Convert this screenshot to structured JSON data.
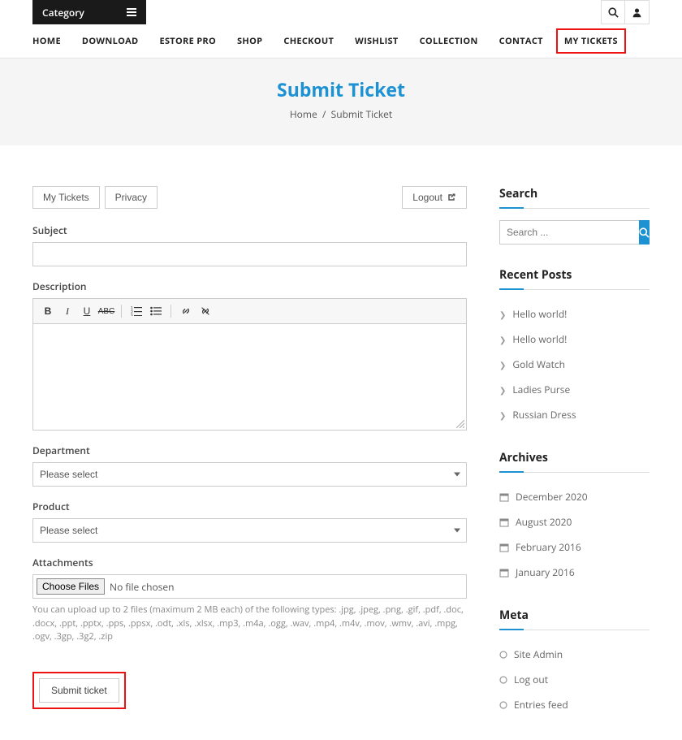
{
  "topbar": {
    "category_label": "Category"
  },
  "nav": {
    "items": [
      "HOME",
      "DOWNLOAD",
      "ESTORE PRO",
      "SHOP",
      "CHECKOUT",
      "WISHLIST",
      "COLLECTION",
      "CONTACT",
      "MY TICKETS"
    ]
  },
  "hero": {
    "title": "Submit Ticket",
    "breadcrumb_home": "Home",
    "breadcrumb_current": "Submit Ticket"
  },
  "ticket_nav": {
    "my_tickets": "My Tickets",
    "privacy": "Privacy",
    "logout": "Logout"
  },
  "form": {
    "subject_label": "Subject",
    "description_label": "Description",
    "department_label": "Department",
    "department_placeholder": "Please select",
    "product_label": "Product",
    "product_placeholder": "Please select",
    "attachments_label": "Attachments",
    "choose_files": "Choose Files",
    "no_file": "No file chosen",
    "help_text": "You can upload up to 2 files (maximum 2 MB each) of the following types: .jpg, .jpeg, .png, .gif, .pdf, .doc, .docx, .ppt, .pptx, .pps, .ppsx, .odt, .xls, .xlsx, .mp3, .m4a, .ogg, .wav, .mp4, .m4v, .mov, .wmv, .avi, .mpg, .ogv, .3gp, .3g2, .zip",
    "submit_label": "Submit ticket"
  },
  "sidebar": {
    "search_title": "Search",
    "search_placeholder": "Search ...",
    "recent_title": "Recent Posts",
    "recent_posts": [
      "Hello world!",
      "Hello world!",
      "Gold Watch",
      "Ladies Purse",
      "Russian Dress"
    ],
    "archives_title": "Archives",
    "archives": [
      "December 2020",
      "August 2020",
      "February 2016",
      "January 2016"
    ],
    "meta_title": "Meta",
    "meta_links": [
      "Site Admin",
      "Log out",
      "Entries feed"
    ]
  },
  "icons": {
    "search": "search-icon",
    "user": "user-icon",
    "hamburger": "hamburger-icon",
    "external": "external-link-icon"
  }
}
